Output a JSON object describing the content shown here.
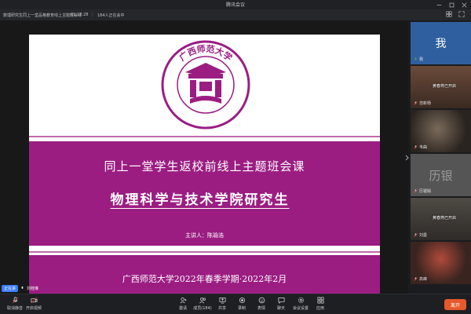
{
  "window": {
    "title": "腾讯会议"
  },
  "infobar": {
    "meeting_topic": "数理研究生同上一堂品格教育线上主题班会课",
    "duration": "01:12:28",
    "participants": "184人正在会中"
  },
  "slide": {
    "logo_text": "广西师范大学",
    "title_line1": "同上一堂学生返校前线上主题班会课",
    "title_line2": "物理科学与技术学院研究生",
    "speaker": "主讲人：陈瑜浩",
    "footer": "广西师范大学2022年春季学期·2022年2月"
  },
  "participants": [
    {
      "name": "我",
      "avatar_text": "我",
      "avatar_color": "#3b6fb6",
      "mic": "mic-on-icon"
    },
    {
      "name": "范新杨",
      "overlay": "黄春燕已开启",
      "mic": "mic-off-icon"
    },
    {
      "name": "韦曲",
      "overlay": "",
      "mic": "mic-off-icon"
    },
    {
      "name": "历银娟",
      "avatar_text": "历银",
      "avatar_color": "#5a5a5a",
      "mic": "mic-off-icon"
    },
    {
      "name": "刘曼",
      "overlay": "黄春燕已开启",
      "mic": "mic-off-icon"
    },
    {
      "name": "高峰",
      "overlay": "",
      "mic": "mic-off-icon"
    }
  ],
  "speaking": {
    "badge": "正在讲",
    "name": "刘桂琳"
  },
  "toolbar": {
    "mic_label": "取消静音",
    "camera_label": "开启视频",
    "items": [
      "邀请",
      "成员(184)",
      "共享",
      "录制",
      "表情",
      "聊天",
      "会议设置",
      "应用"
    ],
    "leave_label": "离开"
  },
  "colors": {
    "accent_purple": "#9b1d82",
    "leave": "#e7592b",
    "speaking": "#3b7cf4"
  }
}
